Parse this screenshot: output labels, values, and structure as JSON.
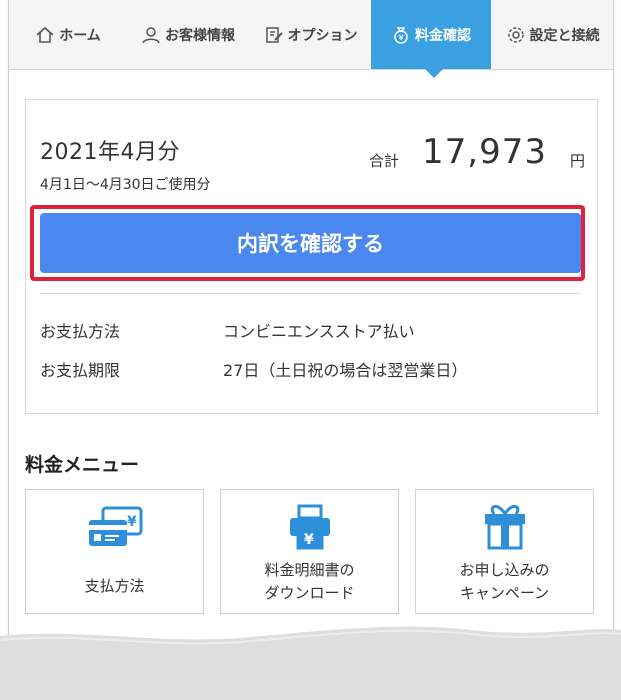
{
  "tabs": [
    {
      "label": "ホーム",
      "icon": "home-icon"
    },
    {
      "label": "お客様情報",
      "icon": "person-icon"
    },
    {
      "label": "オプション",
      "icon": "edit-note-icon"
    },
    {
      "label": "料金確認",
      "icon": "money-bag-icon",
      "active": true
    },
    {
      "label": "設定と接続",
      "icon": "gear-icon"
    }
  ],
  "billing": {
    "month": "2021年4月分",
    "period": "4月1日～4月30日ご使用分",
    "total_label": "合計",
    "total_amount": "17,973",
    "total_unit": "円",
    "detail_button": "内訳を確認する",
    "payment_method_label": "お支払方法",
    "payment_method_value": "コンビニエンスストア払い",
    "payment_deadline_label": "お支払期限",
    "payment_deadline_value": "27日（土日祝の場合は翌営業日）"
  },
  "fee_menu": {
    "title": "料金メニュー",
    "items": [
      {
        "label_line1": "支払方法",
        "label_line2": "",
        "icon": "credit-card-icon"
      },
      {
        "label_line1": "料金明細書の",
        "label_line2": "ダウンロード",
        "icon": "printer-icon"
      },
      {
        "label_line1": "お申し込みの",
        "label_line2": "キャンペーン",
        "icon": "gift-icon"
      }
    ]
  },
  "colors": {
    "accent": "#3aa0e0",
    "button": "#4a87ee",
    "highlight": "#e0203c"
  }
}
